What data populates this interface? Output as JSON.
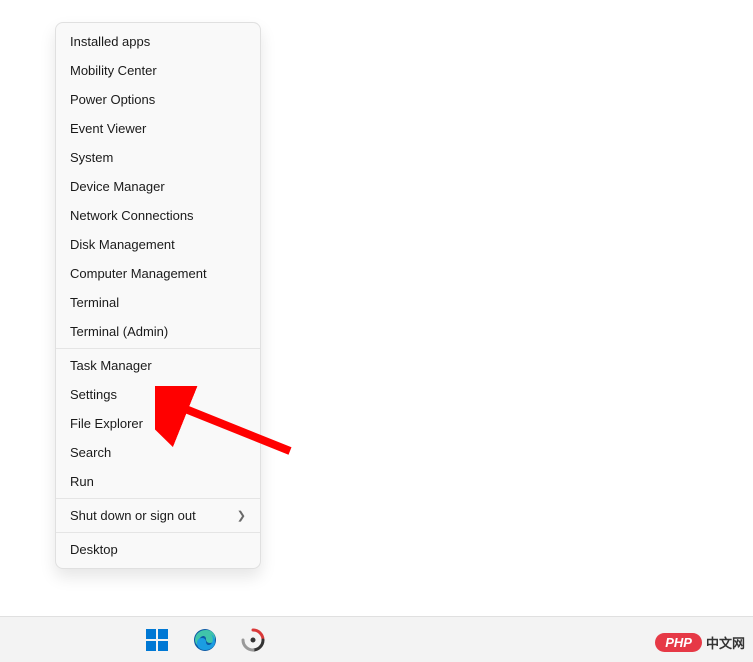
{
  "menu": {
    "group1": [
      "Installed apps",
      "Mobility Center",
      "Power Options",
      "Event Viewer",
      "System",
      "Device Manager",
      "Network Connections",
      "Disk Management",
      "Computer Management",
      "Terminal",
      "Terminal (Admin)"
    ],
    "group2": [
      "Task Manager",
      "Settings",
      "File Explorer",
      "Search",
      "Run"
    ],
    "group3": {
      "shutdown_label": "Shut down or sign out"
    },
    "group4": [
      "Desktop"
    ]
  },
  "taskbar": {
    "icons": {
      "start": "start-icon",
      "edge": "edge-icon",
      "app": "app-icon"
    }
  },
  "watermark": {
    "pill": "PHP",
    "text": "中文网"
  }
}
